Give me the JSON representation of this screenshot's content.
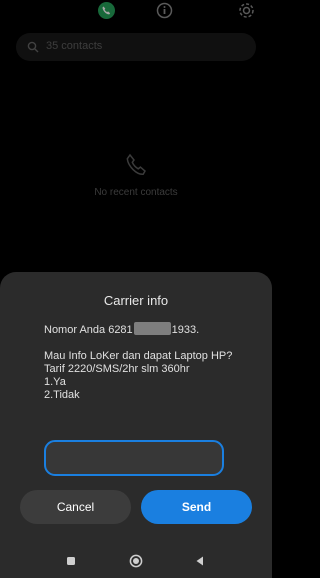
{
  "contacts": {
    "tabs": [
      {
        "name": "phone-icon",
        "color": "#25a25a"
      },
      {
        "name": "info-icon"
      },
      {
        "name": "gear-icon"
      }
    ],
    "search_placeholder": "35 contacts",
    "empty_text": "No recent contacts"
  },
  "dialog": {
    "title": "Carrier info",
    "number_prefix": "Nomor Anda 6281",
    "number_suffix": "1933.",
    "lines": [
      "Mau Info LoKer dan dapat Laptop HP? Tarif 2220/SMS/2hr slm 360hr",
      "1.Ya",
      "2.Tidak"
    ],
    "reply_value": "",
    "cancel_label": "Cancel",
    "send_label": "Send",
    "accent_color": "#1a7fe0"
  },
  "navbar": {
    "icons": [
      "square-icon",
      "circle-home-icon",
      "triangle-back-icon"
    ]
  }
}
